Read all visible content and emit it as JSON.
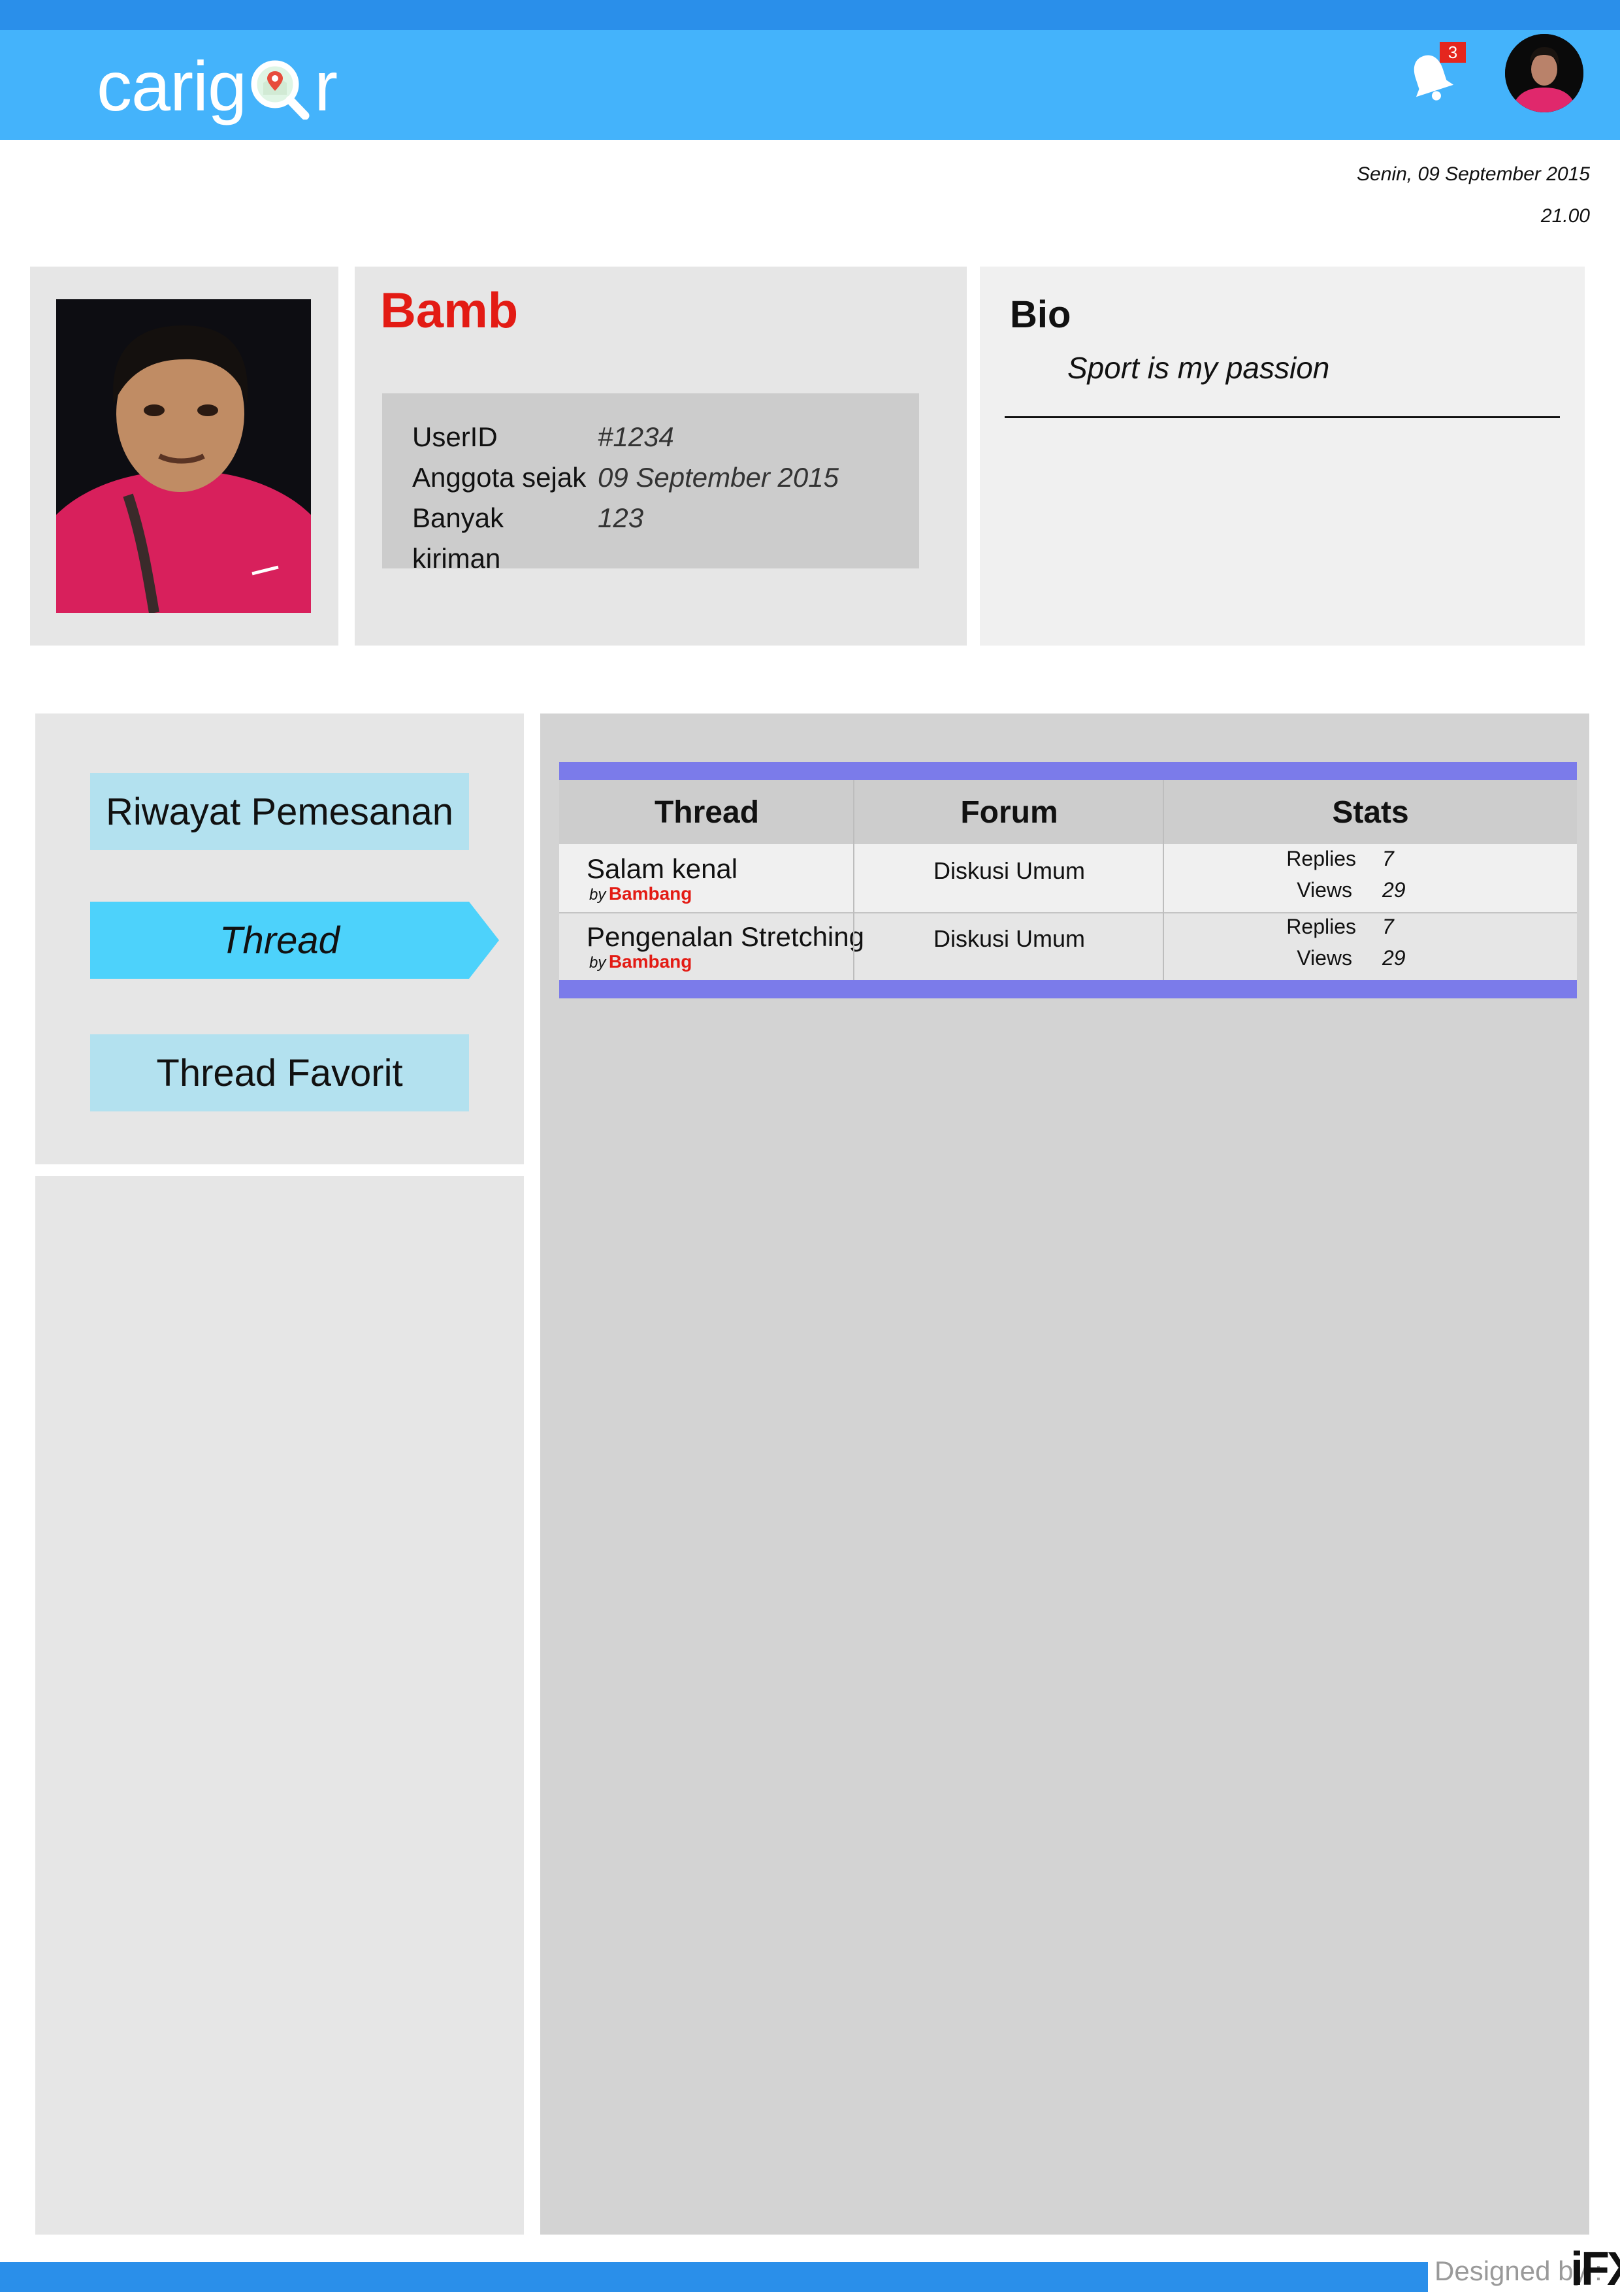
{
  "header": {
    "logo_text_left": "cari",
    "logo_text_g": "g",
    "logo_text_right": "r",
    "notification_count": "3"
  },
  "datetime": {
    "date": "Senin, 09 September 2015",
    "time": "21.00"
  },
  "profile": {
    "username": "Bamb",
    "info": [
      {
        "label": "UserID",
        "value": "#1234"
      },
      {
        "label": "Anggota sejak",
        "value": "09 September 2015"
      },
      {
        "label": "Banyak kiriman",
        "value": "123"
      }
    ],
    "bio_title": "Bio",
    "bio_text": "Sport is my passion"
  },
  "nav": {
    "items": [
      {
        "label": "Riwayat Pemesanan",
        "active": false
      },
      {
        "label": "Thread",
        "active": true
      },
      {
        "label": "Thread Favorit",
        "active": false
      }
    ]
  },
  "threads": {
    "columns": [
      "Thread",
      "Forum",
      "Stats"
    ],
    "by_label": "by",
    "replies_label": "Replies",
    "views_label": "Views",
    "rows": [
      {
        "title": "Salam kenal",
        "author": "Bambang",
        "forum": "Diskusi Umum",
        "replies": "7",
        "views": "29"
      },
      {
        "title": "Pengenalan Stretching",
        "author": "Bambang",
        "forum": "Diskusi Umum",
        "replies": "7",
        "views": "29"
      }
    ]
  },
  "footer": {
    "designed_by": "Designed by :",
    "designer_logo": "iFX"
  },
  "colors": {
    "header": "#44b3fb",
    "header_strip": "#2a8fea",
    "accent_red": "#e31b14",
    "nav_active": "#4dd2fb",
    "nav_inactive": "#b3e1ef",
    "table_band": "#7b7bea"
  }
}
